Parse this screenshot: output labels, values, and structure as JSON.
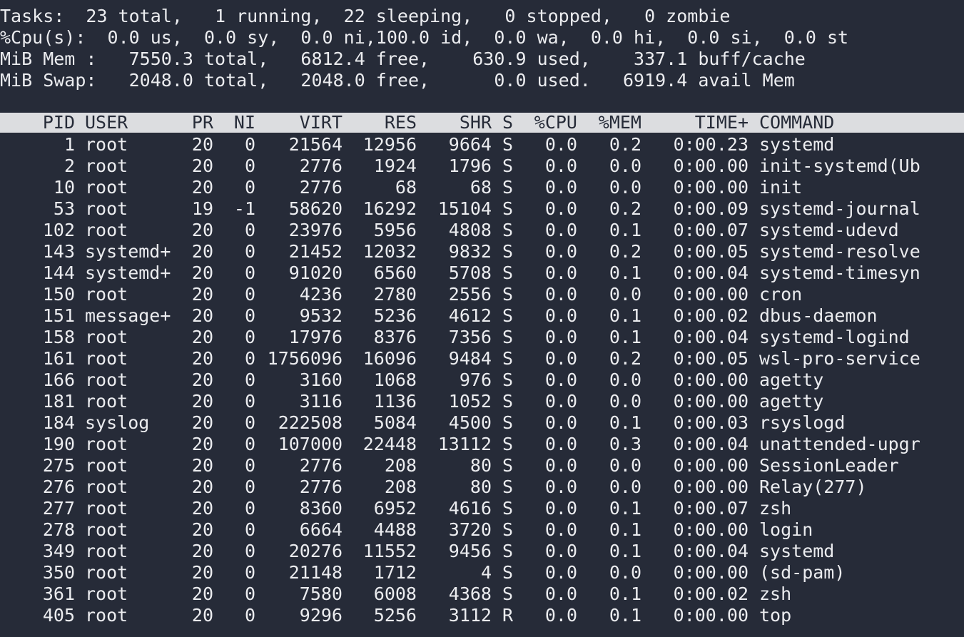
{
  "summary": {
    "tasks": "Tasks:  23 total,   1 running,  22 sleeping,   0 stopped,   0 zombie",
    "cpu": "%Cpu(s):  0.0 us,  0.0 sy,  0.0 ni,100.0 id,  0.0 wa,  0.0 hi,  0.0 si,  0.0 st",
    "mem": "MiB Mem :   7550.3 total,   6812.4 free,    630.9 used,    337.1 buff/cache",
    "swap": "MiB Swap:   2048.0 total,   2048.0 free,      0.0 used.   6919.4 avail Mem"
  },
  "columns": {
    "pid": "PID",
    "user": "USER",
    "pr": "PR",
    "ni": "NI",
    "virt": "VIRT",
    "res": "RES",
    "shr": "SHR",
    "s": "S",
    "cpu": "%CPU",
    "mem": "%MEM",
    "time": "TIME+",
    "command": "COMMAND"
  },
  "processes": [
    {
      "pid": "1",
      "user": "root",
      "pr": "20",
      "ni": "0",
      "virt": "21564",
      "res": "12956",
      "shr": "9664",
      "s": "S",
      "cpu": "0.0",
      "mem": "0.2",
      "time": "0:00.23",
      "command": "systemd"
    },
    {
      "pid": "2",
      "user": "root",
      "pr": "20",
      "ni": "0",
      "virt": "2776",
      "res": "1924",
      "shr": "1796",
      "s": "S",
      "cpu": "0.0",
      "mem": "0.0",
      "time": "0:00.00",
      "command": "init-systemd(Ub"
    },
    {
      "pid": "10",
      "user": "root",
      "pr": "20",
      "ni": "0",
      "virt": "2776",
      "res": "68",
      "shr": "68",
      "s": "S",
      "cpu": "0.0",
      "mem": "0.0",
      "time": "0:00.00",
      "command": "init"
    },
    {
      "pid": "53",
      "user": "root",
      "pr": "19",
      "ni": "-1",
      "virt": "58620",
      "res": "16292",
      "shr": "15104",
      "s": "S",
      "cpu": "0.0",
      "mem": "0.2",
      "time": "0:00.09",
      "command": "systemd-journal"
    },
    {
      "pid": "102",
      "user": "root",
      "pr": "20",
      "ni": "0",
      "virt": "23976",
      "res": "5956",
      "shr": "4808",
      "s": "S",
      "cpu": "0.0",
      "mem": "0.1",
      "time": "0:00.07",
      "command": "systemd-udevd"
    },
    {
      "pid": "143",
      "user": "systemd+",
      "pr": "20",
      "ni": "0",
      "virt": "21452",
      "res": "12032",
      "shr": "9832",
      "s": "S",
      "cpu": "0.0",
      "mem": "0.2",
      "time": "0:00.05",
      "command": "systemd-resolve"
    },
    {
      "pid": "144",
      "user": "systemd+",
      "pr": "20",
      "ni": "0",
      "virt": "91020",
      "res": "6560",
      "shr": "5708",
      "s": "S",
      "cpu": "0.0",
      "mem": "0.1",
      "time": "0:00.04",
      "command": "systemd-timesyn"
    },
    {
      "pid": "150",
      "user": "root",
      "pr": "20",
      "ni": "0",
      "virt": "4236",
      "res": "2780",
      "shr": "2556",
      "s": "S",
      "cpu": "0.0",
      "mem": "0.0",
      "time": "0:00.00",
      "command": "cron"
    },
    {
      "pid": "151",
      "user": "message+",
      "pr": "20",
      "ni": "0",
      "virt": "9532",
      "res": "5236",
      "shr": "4612",
      "s": "S",
      "cpu": "0.0",
      "mem": "0.1",
      "time": "0:00.02",
      "command": "dbus-daemon"
    },
    {
      "pid": "158",
      "user": "root",
      "pr": "20",
      "ni": "0",
      "virt": "17976",
      "res": "8376",
      "shr": "7356",
      "s": "S",
      "cpu": "0.0",
      "mem": "0.1",
      "time": "0:00.04",
      "command": "systemd-logind"
    },
    {
      "pid": "161",
      "user": "root",
      "pr": "20",
      "ni": "0",
      "virt": "1756096",
      "res": "16096",
      "shr": "9484",
      "s": "S",
      "cpu": "0.0",
      "mem": "0.2",
      "time": "0:00.05",
      "command": "wsl-pro-service"
    },
    {
      "pid": "166",
      "user": "root",
      "pr": "20",
      "ni": "0",
      "virt": "3160",
      "res": "1068",
      "shr": "976",
      "s": "S",
      "cpu": "0.0",
      "mem": "0.0",
      "time": "0:00.00",
      "command": "agetty"
    },
    {
      "pid": "181",
      "user": "root",
      "pr": "20",
      "ni": "0",
      "virt": "3116",
      "res": "1136",
      "shr": "1052",
      "s": "S",
      "cpu": "0.0",
      "mem": "0.0",
      "time": "0:00.00",
      "command": "agetty"
    },
    {
      "pid": "184",
      "user": "syslog",
      "pr": "20",
      "ni": "0",
      "virt": "222508",
      "res": "5084",
      "shr": "4500",
      "s": "S",
      "cpu": "0.0",
      "mem": "0.1",
      "time": "0:00.03",
      "command": "rsyslogd"
    },
    {
      "pid": "190",
      "user": "root",
      "pr": "20",
      "ni": "0",
      "virt": "107000",
      "res": "22448",
      "shr": "13112",
      "s": "S",
      "cpu": "0.0",
      "mem": "0.3",
      "time": "0:00.04",
      "command": "unattended-upgr"
    },
    {
      "pid": "275",
      "user": "root",
      "pr": "20",
      "ni": "0",
      "virt": "2776",
      "res": "208",
      "shr": "80",
      "s": "S",
      "cpu": "0.0",
      "mem": "0.0",
      "time": "0:00.00",
      "command": "SessionLeader"
    },
    {
      "pid": "276",
      "user": "root",
      "pr": "20",
      "ni": "0",
      "virt": "2776",
      "res": "208",
      "shr": "80",
      "s": "S",
      "cpu": "0.0",
      "mem": "0.0",
      "time": "0:00.00",
      "command": "Relay(277)"
    },
    {
      "pid": "277",
      "user": "root",
      "pr": "20",
      "ni": "0",
      "virt": "8360",
      "res": "6952",
      "shr": "4616",
      "s": "S",
      "cpu": "0.0",
      "mem": "0.1",
      "time": "0:00.07",
      "command": "zsh"
    },
    {
      "pid": "278",
      "user": "root",
      "pr": "20",
      "ni": "0",
      "virt": "6664",
      "res": "4488",
      "shr": "3720",
      "s": "S",
      "cpu": "0.0",
      "mem": "0.1",
      "time": "0:00.00",
      "command": "login"
    },
    {
      "pid": "349",
      "user": "root",
      "pr": "20",
      "ni": "0",
      "virt": "20276",
      "res": "11552",
      "shr": "9456",
      "s": "S",
      "cpu": "0.0",
      "mem": "0.1",
      "time": "0:00.04",
      "command": "systemd"
    },
    {
      "pid": "350",
      "user": "root",
      "pr": "20",
      "ni": "0",
      "virt": "21148",
      "res": "1712",
      "shr": "4",
      "s": "S",
      "cpu": "0.0",
      "mem": "0.0",
      "time": "0:00.00",
      "command": "(sd-pam)"
    },
    {
      "pid": "361",
      "user": "root",
      "pr": "20",
      "ni": "0",
      "virt": "7580",
      "res": "6008",
      "shr": "4368",
      "s": "S",
      "cpu": "0.0",
      "mem": "0.1",
      "time": "0:00.02",
      "command": "zsh"
    },
    {
      "pid": "405",
      "user": "root",
      "pr": "20",
      "ni": "0",
      "virt": "9296",
      "res": "5256",
      "shr": "3112",
      "s": "R",
      "cpu": "0.0",
      "mem": "0.1",
      "time": "0:00.00",
      "command": "top"
    }
  ]
}
